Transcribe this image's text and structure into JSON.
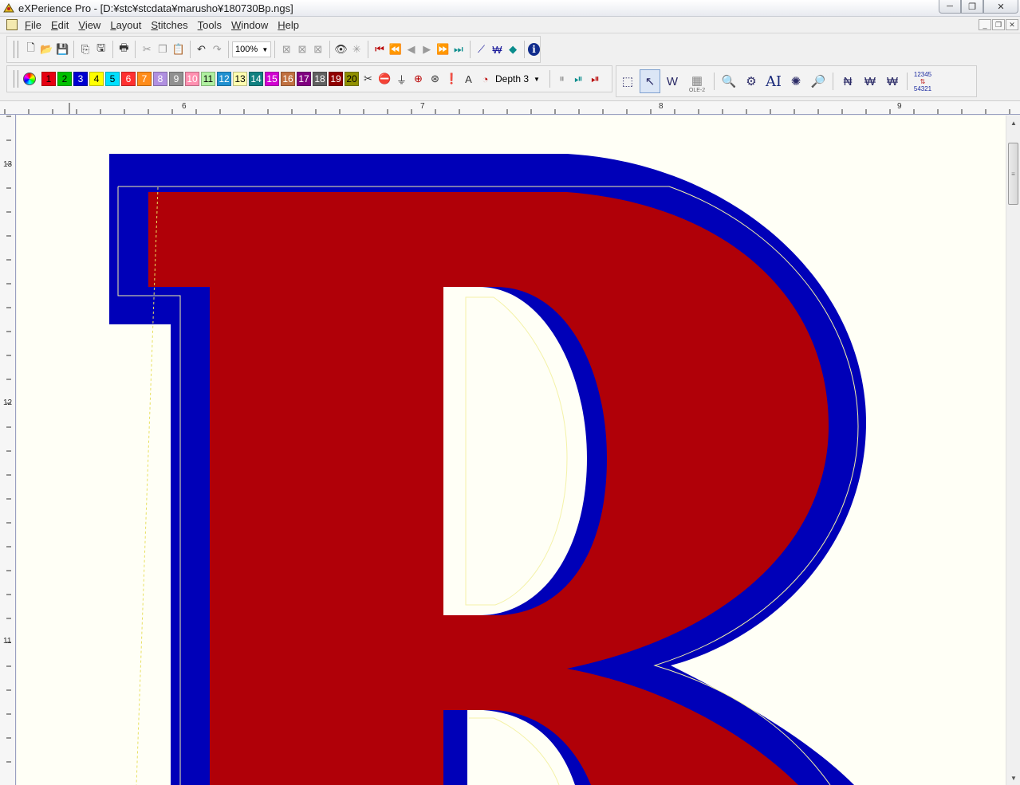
{
  "window": {
    "title": "eXPerience Pro - [D:¥stc¥stcdata¥marusho¥180730Bp.ngs]",
    "minimize_glyph": "─",
    "restore_glyph": "❐",
    "close_glyph": "✕"
  },
  "menu": {
    "items": [
      "File",
      "Edit",
      "View",
      "Layout",
      "Stitches",
      "Tools",
      "Window",
      "Help"
    ]
  },
  "mdi_buttons": [
    "_",
    "❐",
    "✕"
  ],
  "toolbar_main": {
    "zoom_value": "100%",
    "zoom_arrow": "▼",
    "info_glyph": "i"
  },
  "toolbar_color": {
    "colors": [
      {
        "label": "1",
        "bg": "#e60012",
        "fg": "#000000"
      },
      {
        "label": "2",
        "bg": "#00c000",
        "fg": "#000000"
      },
      {
        "label": "3",
        "bg": "#0000d0",
        "fg": "#ffffff"
      },
      {
        "label": "4",
        "bg": "#ffff00",
        "fg": "#000000"
      },
      {
        "label": "5",
        "bg": "#00e0ff",
        "fg": "#000000"
      },
      {
        "label": "6",
        "bg": "#ff3030",
        "fg": "#ffffff"
      },
      {
        "label": "7",
        "bg": "#ff8c1a",
        "fg": "#ffffff"
      },
      {
        "label": "8",
        "bg": "#b090e0",
        "fg": "#ffffff"
      },
      {
        "label": "9",
        "bg": "#909090",
        "fg": "#ffffff"
      },
      {
        "label": "10",
        "bg": "#ff90b0",
        "fg": "#ffffff"
      },
      {
        "label": "11",
        "bg": "#b0f0a0",
        "fg": "#000000"
      },
      {
        "label": "12",
        "bg": "#2090d0",
        "fg": "#ffffff"
      },
      {
        "label": "13",
        "bg": "#ffffb0",
        "fg": "#000000"
      },
      {
        "label": "14",
        "bg": "#108080",
        "fg": "#ffffff"
      },
      {
        "label": "15",
        "bg": "#d000d0",
        "fg": "#ffffff"
      },
      {
        "label": "16",
        "bg": "#c07040",
        "fg": "#ffffff"
      },
      {
        "label": "17",
        "bg": "#800080",
        "fg": "#ffffff"
      },
      {
        "label": "18",
        "bg": "#606060",
        "fg": "#ffffff"
      },
      {
        "label": "19",
        "bg": "#900000",
        "fg": "#ffffff"
      },
      {
        "label": "20",
        "bg": "#909000",
        "fg": "#000000"
      }
    ],
    "depth_label": "Depth 3",
    "depth_arrow": "▼"
  },
  "toolbar_tools": {
    "ole_label": "OLE-2",
    "ai_label": "AI",
    "num_top": "12345",
    "num_bottom": "54321"
  },
  "ruler_top": {
    "labels": [
      "6",
      "7",
      "8",
      "9"
    ]
  },
  "ruler_left": {
    "labels": [
      "13",
      "12",
      "11"
    ]
  },
  "design": {
    "fill_color": "#b00008",
    "outline_color": "#0000b8",
    "run_color": "#f4f2a8",
    "guide_color": "#e8e060",
    "background": "#fffff6"
  },
  "scrollbar": {
    "up_glyph": "▲",
    "down_glyph": "▼",
    "thumb_glyph": "≡"
  }
}
